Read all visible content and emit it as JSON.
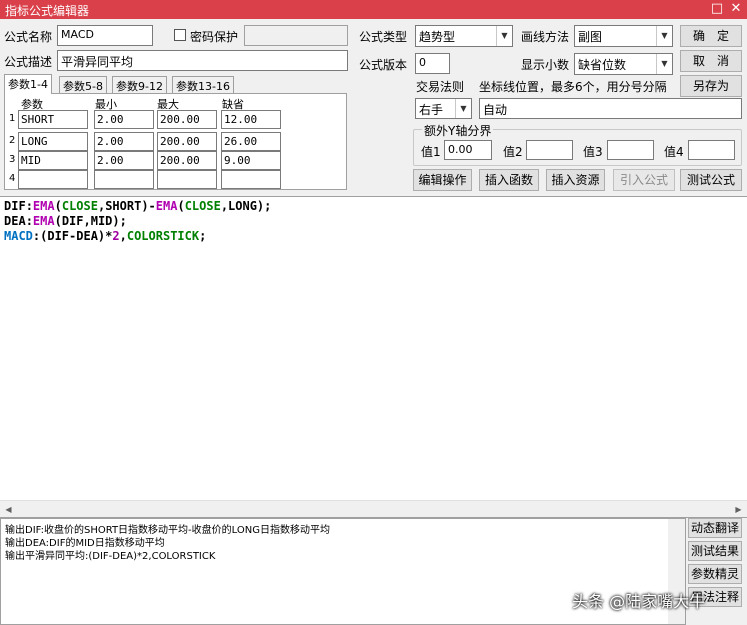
{
  "window": {
    "title": "指标公式编辑器",
    "restore_glyph": "□",
    "close_glyph": "✕"
  },
  "form": {
    "name_label": "公式名称",
    "name_value": "MACD",
    "password_label": "密码保护",
    "desc_label": "公式描述",
    "desc_value": "平滑异同平均",
    "type_label": "公式类型",
    "type_value": "趋势型",
    "draw_label": "画线方法",
    "draw_value": "副图",
    "version_label": "公式版本",
    "version_value": "0",
    "decimal_label": "显示小数",
    "decimal_value": "缺省位数",
    "trade_label": "交易法则",
    "trade_value": "右手",
    "coord_label": "坐标线位置，最多6个，用分号分隔",
    "coord_value": "自动",
    "yaxis_group_label": "额外Y轴分界",
    "yaxis": [
      {
        "label": "值1",
        "value": "0.00"
      },
      {
        "label": "值2",
        "value": ""
      },
      {
        "label": "值3",
        "value": ""
      },
      {
        "label": "值4",
        "value": ""
      }
    ]
  },
  "buttons": {
    "ok": "确　定",
    "cancel": "取　消",
    "save_as": "另存为",
    "edit_ops": "编辑操作",
    "insert_func": "插入函数",
    "insert_res": "插入资源",
    "import_formula": "引入公式",
    "test_formula": "测试公式"
  },
  "tabs": [
    "参数1-4",
    "参数5-8",
    "参数9-12",
    "参数13-16"
  ],
  "params": {
    "headers": [
      "参数",
      "最小",
      "最大",
      "缺省"
    ],
    "rows": [
      {
        "idx": "1",
        "name": "SHORT",
        "min": "2.00",
        "max": "200.00",
        "def": "12.00"
      },
      {
        "idx": "2",
        "name": "LONG",
        "min": "2.00",
        "max": "200.00",
        "def": "26.00"
      },
      {
        "idx": "3",
        "name": "MID",
        "min": "2.00",
        "max": "200.00",
        "def": "9.00"
      },
      {
        "idx": "4",
        "name": "",
        "min": "",
        "max": "",
        "def": ""
      }
    ]
  },
  "code_lines": [
    [
      {
        "t": "DIF",
        "c": "#000000"
      },
      {
        "t": ":",
        "c": "#000000"
      },
      {
        "t": "EMA",
        "c": "#b000b0"
      },
      {
        "t": "(",
        "c": "#000000"
      },
      {
        "t": "CLOSE",
        "c": "#008000"
      },
      {
        "t": ",SHORT)-",
        "c": "#000000"
      },
      {
        "t": "EMA",
        "c": "#b000b0"
      },
      {
        "t": "(",
        "c": "#000000"
      },
      {
        "t": "CLOSE",
        "c": "#008000"
      },
      {
        "t": ",LONG);",
        "c": "#000000"
      }
    ],
    [
      {
        "t": "DEA",
        "c": "#000000"
      },
      {
        "t": ":",
        "c": "#000000"
      },
      {
        "t": "EMA",
        "c": "#b000b0"
      },
      {
        "t": "(DIF,MID);",
        "c": "#000000"
      }
    ],
    [
      {
        "t": "MACD",
        "c": "#0070c0"
      },
      {
        "t": ":(DIF-DEA)*",
        "c": "#000000"
      },
      {
        "t": "2",
        "c": "#a000a0"
      },
      {
        "t": ",",
        "c": "#000000"
      },
      {
        "t": "COLORSTICK",
        "c": "#008000"
      },
      {
        "t": ";",
        "c": "#000000"
      }
    ]
  ],
  "output_lines": [
    "输出DIF:收盘价的SHORT日指数移动平均-收盘价的LONG日指数移动平均",
    "输出DEA:DIF的MID日指数移动平均",
    "输出平滑异同平均:(DIF-DEA)*2,COLORSTICK"
  ],
  "side_buttons": [
    "动态翻译",
    "测试结果",
    "参数精灵",
    "用法注释"
  ],
  "watermark": "头条 @陆家嘴大牛",
  "colors": {
    "titlebar": "#d9404a",
    "keyword_func": "#b000b0",
    "keyword_data": "#008000",
    "output_var": "#0070c0"
  }
}
